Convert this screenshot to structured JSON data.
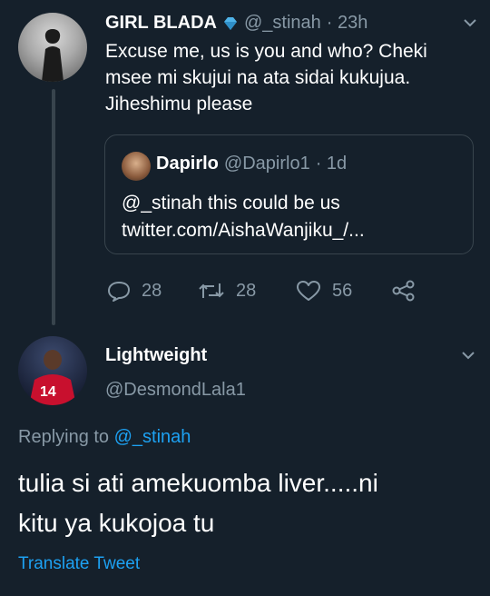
{
  "tweet1": {
    "name": "GIRL BLADA",
    "handle": "@_stinah",
    "time": "· 23h",
    "text_lines": [
      "Excuse me, us is you and who? Cheki",
      "msee mi skujui na ata sidai kukujua.",
      "Jiheshimu please"
    ],
    "quote": {
      "name": "Dapirlo",
      "handle": "@Dapirlo1",
      "time": "· 1d",
      "line1": "@_stinah  this could be us",
      "line2": "twitter.com/AishaWanjiku_/..."
    },
    "actions": {
      "reply_count": "28",
      "retweet_count": "28",
      "like_count": "56"
    }
  },
  "tweet2": {
    "name": "Lightweight",
    "handle": "@DesmondLala1",
    "replying_prefix": "Replying to",
    "replying_handle": "@_stinah",
    "text_lines": [
      "tulia si ati amekuomba liver.....ni",
      "kitu ya kukojoa tu"
    ],
    "translate_label": "Translate Tweet"
  },
  "colors": {
    "background": "#15202b",
    "muted": "#8899a6",
    "accent": "#1da1f2",
    "border": "#38444d"
  }
}
